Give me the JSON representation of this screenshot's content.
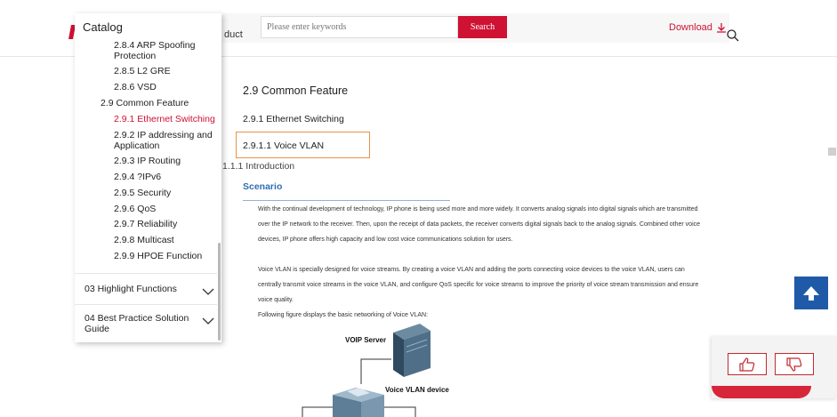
{
  "header": {
    "nav_fragment": "duct",
    "search_placeholder": "Please enter keywords",
    "search_button": "Search",
    "download_label": "Download"
  },
  "catalog": {
    "title": "Catalog",
    "items": [
      {
        "label": "2.8.4 ARP Spoofing Protection"
      },
      {
        "label": "2.8.5 L2 GRE"
      },
      {
        "label": "2.8.6 VSD"
      },
      {
        "label": "2.9 Common Feature"
      },
      {
        "label": "2.9.1 Ethernet Switching"
      },
      {
        "label": "2.9.2 IP addressing and Application"
      },
      {
        "label": "2.9.3 IP Routing"
      },
      {
        "label": "2.9.4 ?IPv6"
      },
      {
        "label": "2.9.5 Security"
      },
      {
        "label": "2.9.6 QoS"
      },
      {
        "label": "2.9.7 Reliability"
      },
      {
        "label": "2.9.8 Multicast"
      },
      {
        "label": "2.9.9 HPOE Function"
      }
    ],
    "active_item": "2.9.1 Ethernet Switching",
    "sections": [
      {
        "label": "03 Highlight Functions"
      },
      {
        "label": "04 Best Practice Solution Guide"
      }
    ]
  },
  "content": {
    "section_heading": "2.9   Common Feature",
    "sub_heading": "2.9.1   Ethernet Switching",
    "voice_heading": "2.9.1.1   Voice VLAN",
    "intro_heading": "1.1.1   Introduction",
    "scenario_heading": "Scenario",
    "paragraph_1": [
      "With the continual development of technology, IP phone is being used more and more widely. It converts analog signals into digital signals which are transmitted",
      "over the IP network to the receiver. Then, upon the receipt of data packets, the receiver converts digital signals back to the analog signals. Combined other voice",
      "devices, IP phone offers high capacity and low cost voice communications solution for users."
    ],
    "paragraph_2": [
      "Voice VLAN is specially designed for voice streams. By creating a voice VLAN and adding the ports connecting voice devices to the voice VLAN, users can",
      "centrally transmit voice streams in the voice VLAN, and configure QoS specific for voice streams to improve the priority of voice stream transmission and ensure",
      "voice quality."
    ],
    "figure_caption": "Following figure displays the basic networking of Voice VLAN:",
    "diagram": {
      "server_label": "VOIP Server",
      "device_label": "Voice VLAN device"
    }
  },
  "colors": {
    "brand_red": "#cf1133",
    "link_blue": "#2e6fb2",
    "highlight_orange": "#e8924a",
    "back_to_top_blue": "#1f5aa8"
  },
  "icons": {
    "download": "download-arrow-icon",
    "search": "magnifier-icon",
    "back_to_top": "arrow-up-icon",
    "like": "thumbs-up-icon",
    "dislike": "thumbs-down-icon",
    "expand": "chevron-down-icon"
  }
}
